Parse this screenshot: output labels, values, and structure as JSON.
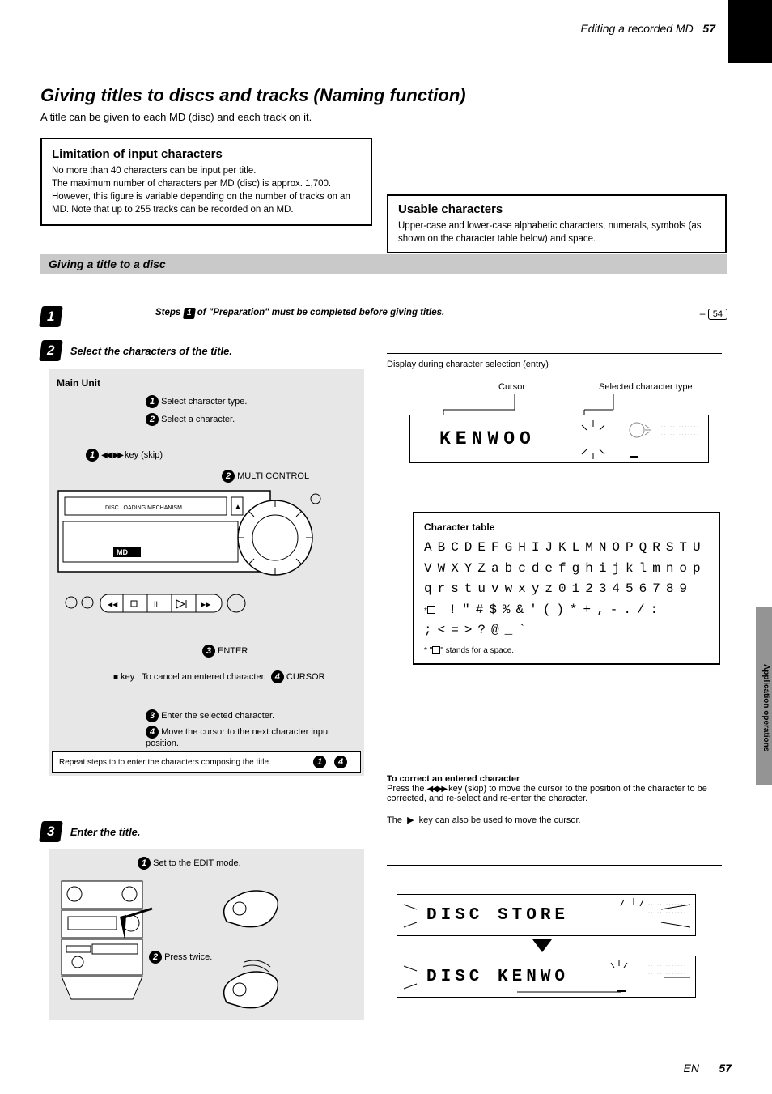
{
  "page": {
    "top_label": "Editing a recorded MD",
    "top_num": "57",
    "bottom_en": "EN",
    "bottom_num": "57"
  },
  "title": {
    "main": "Giving titles to discs and tracks (Naming function)",
    "sub": "A title can be given to each MD (disc) and each track on it."
  },
  "limit_box": {
    "label": "Limitation of input characters",
    "line1": "No more than 40 characters can be input per title.",
    "line2": "The maximum number of characters per MD (disc) is approx. 1,700. However, this figure is variable depending on the number of tracks on an MD. Note that up to 255 tracks can be recorded on an MD."
  },
  "usable_box": {
    "label": "Usable characters",
    "text": "Upper-case and lower-case alphabetic characters, numerals, symbols (as shown on the character table below) and space."
  },
  "grey_bar": "Giving a title to a disc",
  "step1": {
    "badge": "1",
    "label_prefix": "Steps ",
    "label_suffix": " of \"Preparation\" must be completed before giving titles.",
    "ref": "54"
  },
  "step2": {
    "badge": "2",
    "label": "Select the characters of the title."
  },
  "panel1": {
    "title": "Main Unit",
    "sub1_line1": "Select character type.",
    "sub1_line2": "Select a character.",
    "skip_label": "key (skip)",
    "sub2_labels": "MULTI CONTROL",
    "stop_row_text": "key : To cancel an entered character.",
    "sub3_line": "Enter the selected character.",
    "sub4_line": "Move the cursor to the next character input position.",
    "bottom_bar": "Repeat steps     to     to enter the characters composing the title."
  },
  "step3": {
    "badge": "3",
    "label": "Enter the title.",
    "sub1": "Set to the EDIT mode.",
    "sub2": "Press twice."
  },
  "right": {
    "hdr": "Display during character selection (entry)",
    "cursor_label": "Cursor",
    "lcd1": "KENWOO",
    "sel_label": "Selected character type",
    "table_title": "Character table",
    "row1": "ABCDEFGHIJKLMNOPQRSTU",
    "row2": "VWXYZabcdefghijklmnop",
    "row3": "qrstuvwxyz0123456789",
    "row4_prefix": "*",
    "row4": "!\"#$%&'()*+,-./:",
    "row5": ";<=>?@_`",
    "note_star": "* \"   \" stands for a space.",
    "correct_title": "To correct an entered character",
    "correct_body_a": "Press the        key (skip) to move the cursor to the position of the character to be corrected, and re-select and re-enter the character.",
    "correct_body_b": "The    key can also be used to move the cursor.",
    "lcd2a": "DISC STORE",
    "lcd2b": "DISC  KENWO"
  },
  "side_tab": "Application operations"
}
